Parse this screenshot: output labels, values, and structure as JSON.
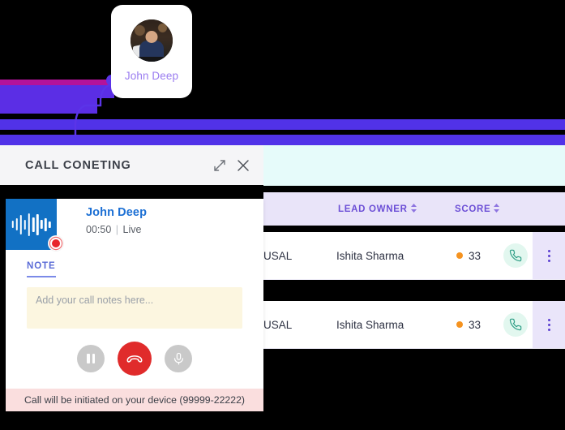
{
  "background": {
    "node_label": "John Deep",
    "colors": {
      "magenta_bar": "#b4139b",
      "violet_bar": "#5b2ee5",
      "violet_rail": "#5132e8",
      "node_dot": "#5b34e8",
      "cyan_band": "#e6fbfa"
    }
  },
  "avatar_card": {
    "name": "John Deep",
    "avatar_alt": "user-photo",
    "name_color": "#9a7cf0"
  },
  "call_panel": {
    "title": "CALL CONETING",
    "expand_icon": "expand-diagonal-icon",
    "close_icon": "close-icon",
    "caller": {
      "name": "John Deep",
      "duration": "00:50",
      "separator": "|",
      "state": "Live",
      "waveform_icon": "audio-waveform-icon",
      "recording_icon": "record-dot-icon"
    },
    "tabs": [
      {
        "label": "NOTE",
        "active": true
      }
    ],
    "note": {
      "placeholder": "Add your call notes here...",
      "value": "",
      "background": "#fcf6e0"
    },
    "controls": [
      {
        "name": "pause-call-button",
        "icon": "pause-icon",
        "color": "#c9c9c9"
      },
      {
        "name": "end-call-button",
        "icon": "phone-hangup-icon",
        "color": "#e02b2b"
      },
      {
        "name": "mute-microphone-button",
        "icon": "microphone-icon",
        "color": "#c9c9c9"
      }
    ],
    "footer_note": "Call will be initiated on your device (99999-22222)",
    "footer_background": "#fadede",
    "accent_color": "#1b6fd4"
  },
  "table": {
    "header_background": "#e9e4f9",
    "header_text_color": "#6c4fd6",
    "columns": [
      {
        "label": "LEAD OWNER",
        "sortable": true
      },
      {
        "label": "SCORE",
        "sortable": true
      }
    ],
    "rows": [
      {
        "stage": "USAL",
        "lead_owner": "Ishita Sharma",
        "score": "33",
        "score_dot_color": "#f59320",
        "call_icon": "phone-icon",
        "menu_icon": "kebab-menu-icon"
      },
      {
        "stage": "USAL",
        "lead_owner": "Ishita Sharma",
        "score": "33",
        "score_dot_color": "#f59320",
        "call_icon": "phone-icon",
        "menu_icon": "kebab-menu-icon"
      }
    ]
  }
}
